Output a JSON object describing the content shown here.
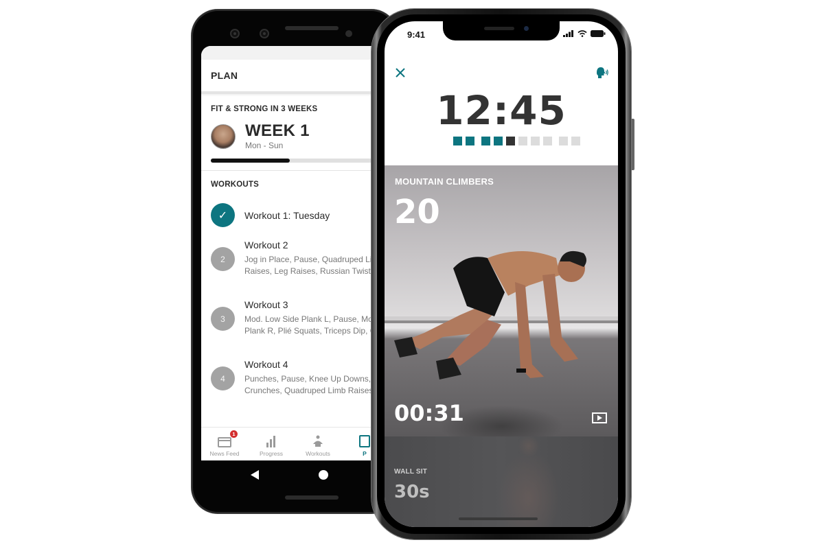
{
  "android": {
    "header": {
      "title": "PLAN"
    },
    "plan": {
      "title": "FIT & STRONG IN 3 WEEKS",
      "week_title": "WEEK 1",
      "week_range": "Mon - Sun",
      "week_progress_pct": 47
    },
    "workouts": {
      "title": "WORKOUTS",
      "items": [
        {
          "badge": "✓",
          "name": "Workout 1: Tuesday",
          "desc_line1": "",
          "desc_line2": "",
          "completed": true
        },
        {
          "badge": "2",
          "name": "Workout 2",
          "desc_line1": "Jog in Place, Pause, Quadruped Li",
          "desc_line2": "Raises, Leg Raises, Russian Twist",
          "completed": false
        },
        {
          "badge": "3",
          "name": "Workout 3",
          "desc_line1": "Mod. Low Side Plank L, Pause, Mo",
          "desc_line2": "Plank R, Plié Squats, Triceps Dip, C",
          "completed": false
        },
        {
          "badge": "4",
          "name": "Workout 4",
          "desc_line1": "Punches, Pause, Knee Up Downs, I",
          "desc_line2": "Crunches, Quadruped Limb Raises",
          "completed": false
        }
      ]
    },
    "bottom_nav": {
      "items": [
        {
          "label": "News Feed",
          "icon": "news-feed-icon",
          "badge": "1"
        },
        {
          "label": "Progress",
          "icon": "progress-icon"
        },
        {
          "label": "Workouts",
          "icon": "workouts-icon"
        },
        {
          "label": "P",
          "icon": "plan-icon",
          "active": true
        }
      ]
    },
    "system_nav": {
      "back": "back-icon",
      "home": "home-icon"
    }
  },
  "iphone": {
    "status": {
      "time": "9:41"
    },
    "workout": {
      "total_timer": "12:45",
      "segments_total": 10,
      "segments_done": 4,
      "segment_current": 5,
      "accent_color": "#0d7580"
    },
    "current_exercise": {
      "name": "MOUNTAIN CLIMBERS",
      "reps": "20",
      "elapsed": "00:31"
    },
    "next_exercise": {
      "name": "WALL SIT",
      "duration": "30s"
    }
  }
}
